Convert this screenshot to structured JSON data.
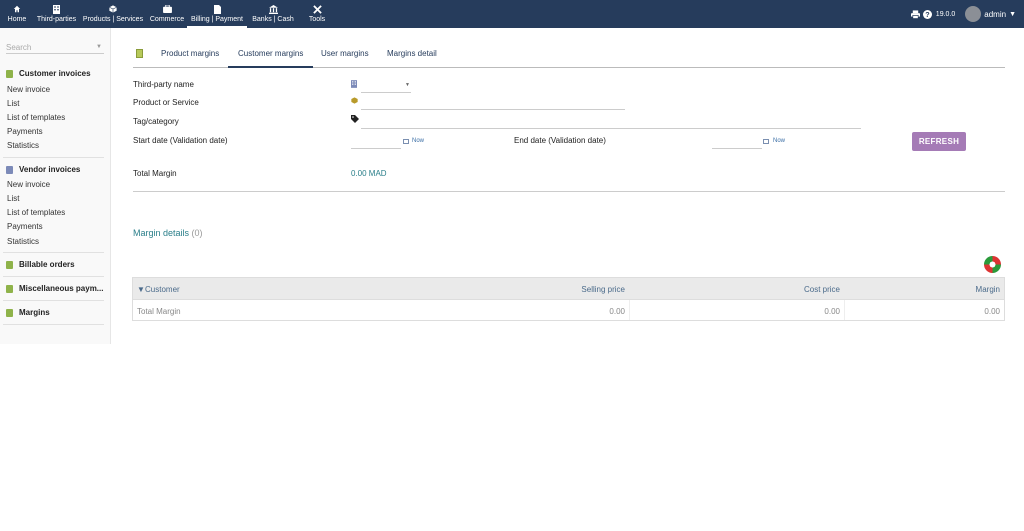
{
  "topnav": {
    "items": [
      {
        "label": "Home",
        "icon": "home-icon"
      },
      {
        "label": "Third-parties",
        "icon": "building-icon"
      },
      {
        "label": "Products | Services",
        "icon": "cube-icon"
      },
      {
        "label": "Commerce",
        "icon": "briefcase-icon"
      },
      {
        "label": "Billing | Payment",
        "icon": "file-icon",
        "active": true
      },
      {
        "label": "Banks | Cash",
        "icon": "bank-icon"
      },
      {
        "label": "Tools",
        "icon": "tools-icon"
      }
    ],
    "version": "19.0.0",
    "user": "admin"
  },
  "sidebar": {
    "search_placeholder": "Search",
    "sections": [
      {
        "title": "Customer invoices",
        "items": [
          "New invoice",
          "List",
          "List of templates",
          "Payments",
          "Statistics"
        ]
      },
      {
        "title": "Vendor invoices",
        "items": [
          "New invoice",
          "List",
          "List of templates",
          "Payments",
          "Statistics"
        ]
      },
      {
        "title": "Billable orders",
        "items": []
      },
      {
        "title": "Miscellaneous paym...",
        "items": []
      },
      {
        "title": "Margins",
        "items": []
      }
    ]
  },
  "tabs": [
    "Product margins",
    "Customer margins",
    "User margins",
    "Margins detail"
  ],
  "active_tab": "Customer margins",
  "form": {
    "third_party_label": "Third-party name",
    "product_label": "Product or Service",
    "tag_label": "Tag/category",
    "start_date_label": "Start date (Validation date)",
    "end_date_label": "End date (Validation date)",
    "now_label": "Now",
    "refresh_label": "REFRESH",
    "total_margin_label": "Total Margin",
    "total_margin_value": "0.00 MAD"
  },
  "details": {
    "title": "Margin details",
    "count": "(0)",
    "columns": [
      "Customer",
      "Selling price",
      "Cost price",
      "Margin"
    ],
    "total_row": {
      "label": "Total Margin",
      "selling": "0.00",
      "cost": "0.00",
      "margin": "0.00"
    }
  },
  "colors": {
    "topbar": "#263c5c",
    "refresh": "#a57bb6",
    "link": "#2a7f8a"
  }
}
